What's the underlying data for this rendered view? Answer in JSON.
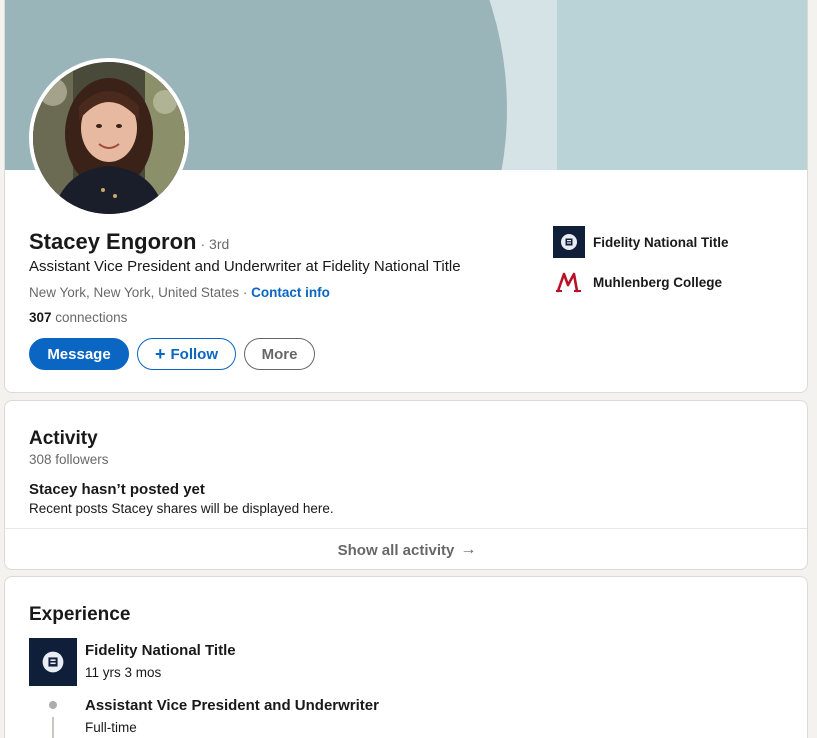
{
  "profile": {
    "name": "Stacey Engoron",
    "degree": "· 3rd",
    "headline": "Assistant Vice President and Underwriter at Fidelity National Title",
    "location": "New York, New York, United States",
    "separator": " · ",
    "contact_label": "Contact info",
    "connections_count": "307",
    "connections_label": " connections",
    "buttons": {
      "message": "Message",
      "follow": "Follow",
      "more": "More"
    },
    "orgs": [
      {
        "label": "Fidelity National Title",
        "icon": "fidelity-logo-icon"
      },
      {
        "label": "Muhlenberg College",
        "icon": "muhlenberg-logo-icon"
      }
    ]
  },
  "activity": {
    "title": "Activity",
    "followers": "308 followers",
    "empty_title": "Stacey hasn’t posted yet",
    "empty_desc": "Recent posts Stacey shares will be displayed here.",
    "show_all": "Show all activity",
    "arrow": "→"
  },
  "experience": {
    "title": "Experience",
    "company": "Fidelity National Title",
    "duration": "11 yrs 3 mos",
    "role_title": "Assistant Vice President and Underwriter",
    "role_type": "Full-time"
  },
  "colors": {
    "brand_blue": "#0a66c2",
    "cover_light": "#b9d3d6",
    "cover_dark": "#9ab5b9",
    "fidelity_navy": "#0f1f3a",
    "muhlenberg_red": "#b8122a"
  }
}
